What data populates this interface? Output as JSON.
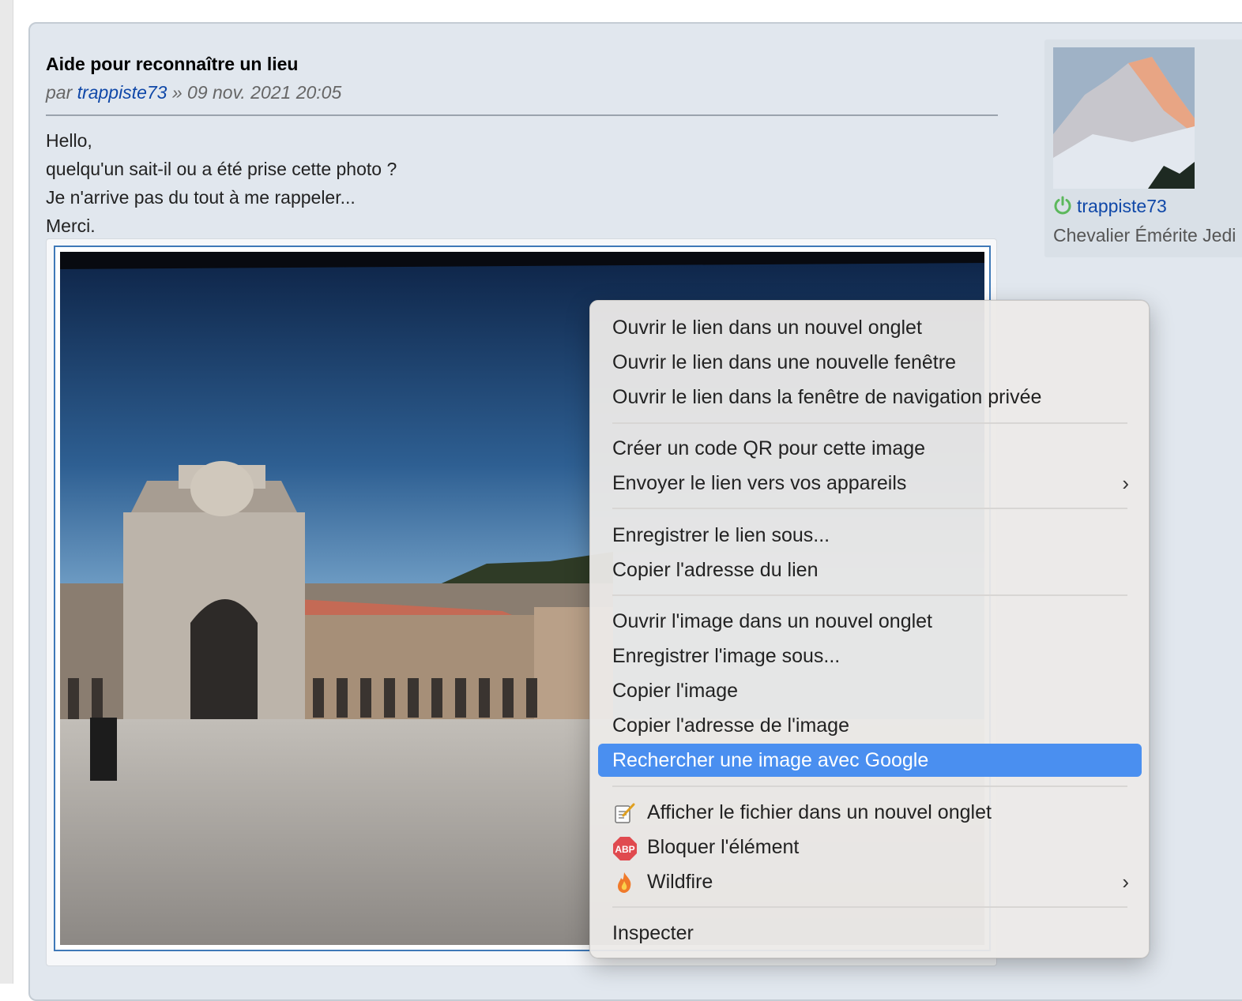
{
  "post": {
    "title": "Aide pour reconnaître un lieu",
    "meta_prefix": "par ",
    "author": "trappiste73",
    "meta_suffix": " » 09 nov. 2021 20:05",
    "body_lines": [
      "Hello,",
      "quelqu'un sait-il ou a été prise cette photo ?",
      "Je n'arrive pas du tout à me rappeler...",
      "Merci."
    ]
  },
  "profile": {
    "username": "trappiste73",
    "rank": "Chevalier Émérite Jedi"
  },
  "context_menu": {
    "items": [
      {
        "label": "Ouvrir le lien dans un nouvel onglet"
      },
      {
        "label": "Ouvrir le lien dans une nouvelle fenêtre"
      },
      {
        "label": "Ouvrir le lien dans la fenêtre de navigation privée"
      },
      {
        "label": "Créer un code QR pour cette image"
      },
      {
        "label": "Envoyer le lien vers vos appareils",
        "submenu": "›"
      },
      {
        "label": "Enregistrer le lien sous..."
      },
      {
        "label": "Copier l'adresse du lien"
      },
      {
        "label": "Ouvrir l'image dans un nouvel onglet"
      },
      {
        "label": "Enregistrer l'image sous..."
      },
      {
        "label": "Copier l'image"
      },
      {
        "label": "Copier l'adresse de l'image"
      },
      {
        "label": "Rechercher une image avec Google",
        "highlighted": true
      },
      {
        "label": "Afficher le fichier dans un nouvel onglet",
        "icon": "file-viewer-icon"
      },
      {
        "label": "Bloquer l'élément",
        "icon": "adblock-plus-icon",
        "icon_text": "ABP"
      },
      {
        "label": "Wildfire",
        "icon": "wildfire-icon",
        "submenu": "›"
      },
      {
        "label": "Inspecter"
      }
    ]
  },
  "colors": {
    "link": "#1048a8",
    "highlight": "#4a8ff0",
    "online": "#5cb85c",
    "post_bg": "#e1e7ee"
  }
}
